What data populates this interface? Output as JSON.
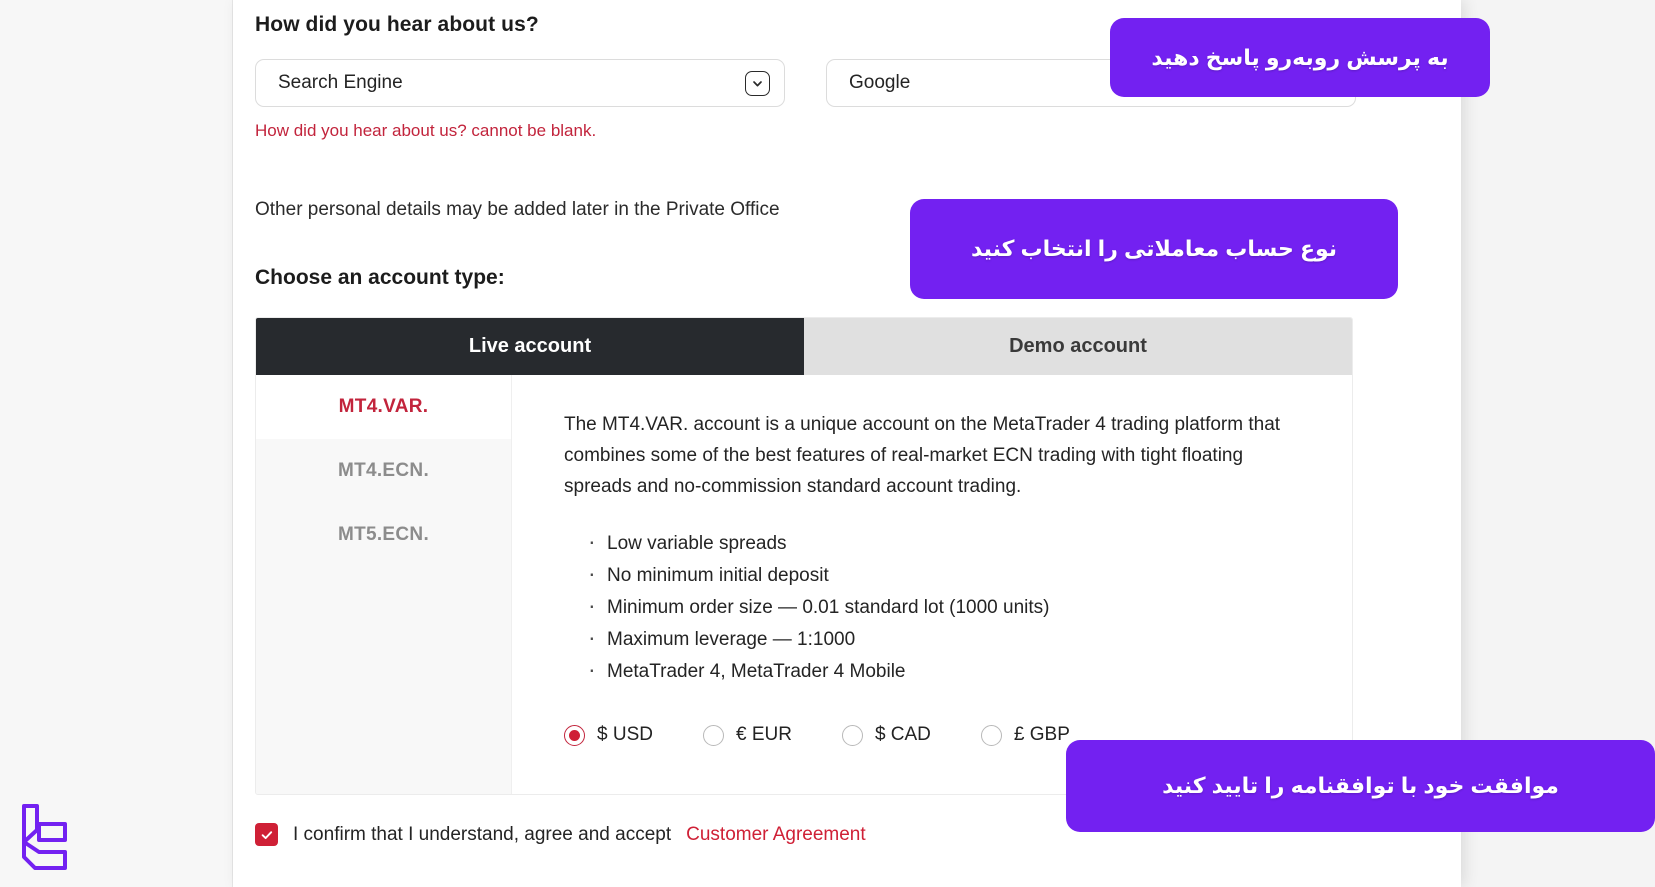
{
  "brand": {
    "logo_name": "lc-monogram-logo",
    "accent": "#7321f1"
  },
  "colors": {
    "accent_purple": "#7321f1",
    "error_red": "#c2243c",
    "brand_red": "#cf2036",
    "tab_active_bg": "#272a2e",
    "tab_inactive_bg": "#e0e0e0"
  },
  "form": {
    "hear_about_us": {
      "label": "How did you hear about us?",
      "select_value": "Search Engine",
      "select_icon": "chevron-down-icon",
      "detail_value": "Google",
      "error": "How did you hear about us? cannot be blank."
    },
    "note": "Other personal details may be added later in the Private Office"
  },
  "account_section": {
    "title": "Choose an account type:",
    "tabs": [
      {
        "label": "Live account",
        "active": true
      },
      {
        "label": "Demo account",
        "active": false
      }
    ],
    "account_types": [
      {
        "label": "MT4.VAR.",
        "selected": true
      },
      {
        "label": "MT4.ECN.",
        "selected": false
      },
      {
        "label": "MT5.ECN.",
        "selected": false
      }
    ],
    "detail": {
      "description": "The MT4.VAR. account is a unique account on the MetaTrader 4 trading platform that combines some of the best features of real-market ECN trading with tight floating spreads and no-commission standard account trading.",
      "features": [
        "Low variable spreads",
        "No minimum initial deposit",
        "Minimum order size — 0.01 standard lot (1000 units)",
        "Maximum leverage — 1:1000",
        "MetaTrader 4, MetaTrader 4 Mobile"
      ],
      "currencies": [
        {
          "label": "$ USD",
          "checked": true
        },
        {
          "label": "€ EUR",
          "checked": false
        },
        {
          "label": "$ CAD",
          "checked": false
        },
        {
          "label": "£ GBP",
          "checked": false
        }
      ]
    }
  },
  "confirm": {
    "checked": true,
    "text": "I confirm that I understand, agree and accept ",
    "link_text": "Customer Agreement"
  },
  "tooltips": [
    {
      "id": "tip-1",
      "text": "به پرسش روبه‌رو پاسخ دهید"
    },
    {
      "id": "tip-2",
      "text": "نوع حساب معاملاتی را انتخاب کنید"
    },
    {
      "id": "tip-3",
      "text": "موافقت خود با توافقنامه را تایید کنید"
    }
  ]
}
